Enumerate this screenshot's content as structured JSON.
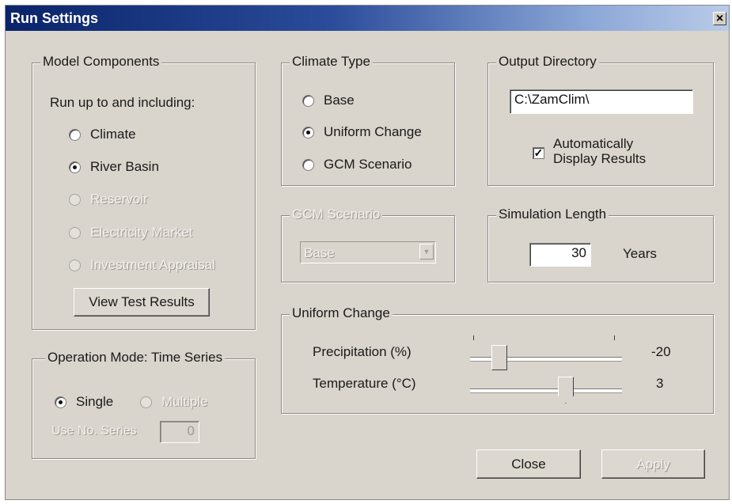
{
  "window": {
    "title": "Run Settings",
    "close_glyph": "×"
  },
  "model_components": {
    "legend": "Model Components",
    "instruction": "Run up to and including:",
    "options": [
      {
        "label": "Climate",
        "checked": false,
        "enabled": true
      },
      {
        "label": "River Basin",
        "checked": true,
        "enabled": true
      },
      {
        "label": "Reservoir",
        "checked": false,
        "enabled": false
      },
      {
        "label": "Electricity Market",
        "checked": false,
        "enabled": false
      },
      {
        "label": "Investment Appraisal",
        "checked": false,
        "enabled": false
      }
    ],
    "view_test_results": "View Test Results"
  },
  "operation_mode": {
    "legend": "Operation Mode: Time Series",
    "single": "Single",
    "multiple": "Multiple",
    "use_no_series_label": "Use No. Series",
    "use_no_series_value": "0"
  },
  "climate_type": {
    "legend": "Climate Type",
    "options": [
      {
        "label": "Base",
        "checked": false
      },
      {
        "label": "Uniform Change",
        "checked": true
      },
      {
        "label": "GCM Scenario",
        "checked": false
      }
    ]
  },
  "gcm_scenario": {
    "legend": "GCM Scenario",
    "selected": "Base"
  },
  "output_directory": {
    "legend": "Output Directory",
    "path": "C:\\ZamClim\\",
    "auto_display_line1": "Automatically",
    "auto_display_line2": "Display Results",
    "auto_display_checked": true
  },
  "simulation_length": {
    "legend": "Simulation Length",
    "value": "30",
    "unit": "Years"
  },
  "uniform_change": {
    "legend": "Uniform Change",
    "precipitation_label": "Precipitation (%)",
    "precipitation_value": "-20",
    "temperature_label": "Temperature (°C)",
    "temperature_value": "3"
  },
  "buttons": {
    "close": "Close",
    "apply": "Apply"
  },
  "colors": {
    "title_start": "#0a246a",
    "title_end": "#b9cbe8",
    "face": "#d9d4cc"
  }
}
